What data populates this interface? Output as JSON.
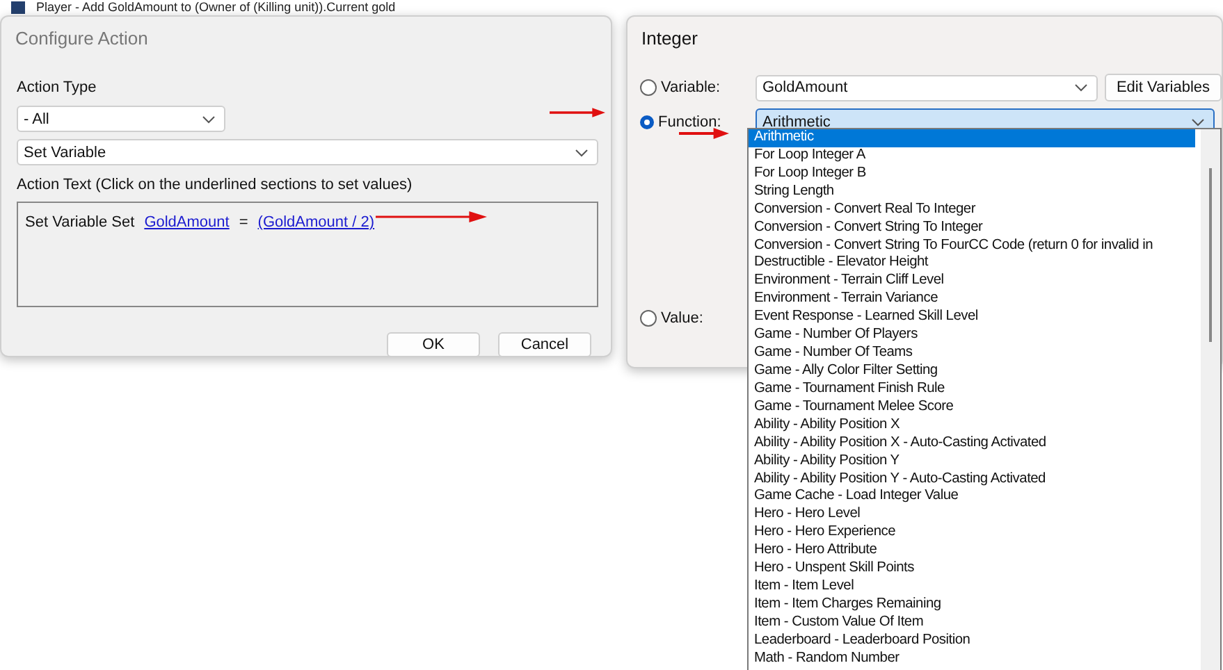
{
  "background_row": {
    "text": "Player - Add GoldAmount to (Owner of (Killing unit)).Current gold"
  },
  "configure_action": {
    "title": "Configure Action",
    "action_type_label": "Action Type",
    "category_value": "- All",
    "action_value": "Set Variable",
    "action_text_label": "Action Text (Click on the underlined sections to set values)",
    "action_text": [
      {
        "kind": "plain",
        "text": "Set Variable Set"
      },
      {
        "kind": "link",
        "text": "GoldAmount"
      },
      {
        "kind": "plain",
        "text": "="
      },
      {
        "kind": "link",
        "text": "(GoldAmount / 2)"
      }
    ],
    "buttons": [
      "OK",
      "Cancel"
    ]
  },
  "integer_dialog": {
    "title": "Integer",
    "options": [
      {
        "label": "Variable:",
        "selected": false
      },
      {
        "label": "Function:",
        "selected": true
      },
      {
        "label": "Value:",
        "selected": false
      }
    ],
    "variable_value": "GoldAmount",
    "edit_variables_button": "Edit Variables",
    "function_value": "Arithmetic",
    "function_list": [
      {
        "label": "Arithmetic",
        "selected": true
      },
      {
        "label": "For Loop Integer A",
        "selected": false
      },
      {
        "label": "For Loop Integer B",
        "selected": false
      },
      {
        "label": "String Length",
        "selected": false
      },
      {
        "label": "Conversion - Convert Real To Integer",
        "selected": false
      },
      {
        "label": "Conversion - Convert String To Integer",
        "selected": false
      },
      {
        "label": "Conversion - Convert String To FourCC Code (return 0 for invalid in",
        "selected": false
      },
      {
        "label": "Destructible - Elevator Height",
        "selected": false
      },
      {
        "label": "Environment - Terrain Cliff Level",
        "selected": false
      },
      {
        "label": "Environment - Terrain Variance",
        "selected": false
      },
      {
        "label": "Event Response - Learned Skill Level",
        "selected": false
      },
      {
        "label": "Game - Number Of Players",
        "selected": false
      },
      {
        "label": "Game - Number Of Teams",
        "selected": false
      },
      {
        "label": "Game - Ally Color Filter Setting",
        "selected": false
      },
      {
        "label": "Game - Tournament Finish Rule",
        "selected": false
      },
      {
        "label": "Game - Tournament Melee Score",
        "selected": false
      },
      {
        "label": "Ability - Ability Position X",
        "selected": false
      },
      {
        "label": "Ability - Ability Position X - Auto-Casting Activated",
        "selected": false
      },
      {
        "label": "Ability - Ability Position Y",
        "selected": false
      },
      {
        "label": "Ability - Ability Position Y - Auto-Casting Activated",
        "selected": false
      },
      {
        "label": "Game Cache - Load Integer Value",
        "selected": false
      },
      {
        "label": "Hero - Hero Level",
        "selected": false
      },
      {
        "label": "Hero - Hero Experience",
        "selected": false
      },
      {
        "label": "Hero - Hero Attribute",
        "selected": false
      },
      {
        "label": "Hero - Unspent Skill Points",
        "selected": false
      },
      {
        "label": "Item - Item Level",
        "selected": false
      },
      {
        "label": "Item - Item Charges Remaining",
        "selected": false
      },
      {
        "label": "Item - Custom Value Of Item",
        "selected": false
      },
      {
        "label": "Leaderboard - Leaderboard Position",
        "selected": false
      },
      {
        "label": "Math - Random Number",
        "selected": false
      }
    ]
  }
}
